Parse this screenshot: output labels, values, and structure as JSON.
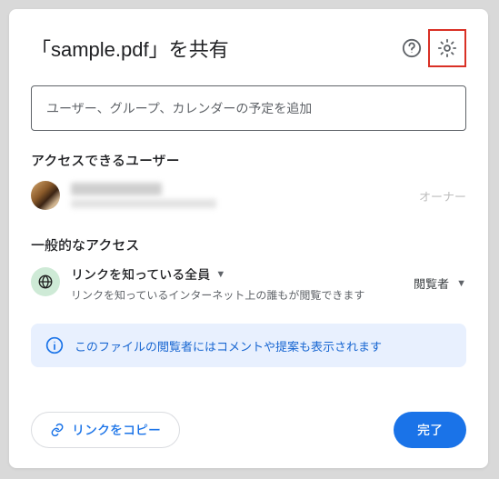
{
  "header": {
    "title": "「sample.pdf」を共有"
  },
  "input": {
    "placeholder": "ユーザー、グループ、カレンダーの予定を追加"
  },
  "access_users": {
    "label": "アクセスできるユーザー",
    "owner_label": "オーナー"
  },
  "general_access": {
    "label": "一般的なアクセス",
    "scope_title": "リンクを知っている全員",
    "scope_desc": "リンクを知っているインターネット上の誰もが閲覧できます",
    "role": "閲覧者"
  },
  "banner": {
    "text": "このファイルの閲覧者にはコメントや提案も表示されます"
  },
  "footer": {
    "copy_label": "リンクをコピー",
    "done_label": "完了"
  }
}
